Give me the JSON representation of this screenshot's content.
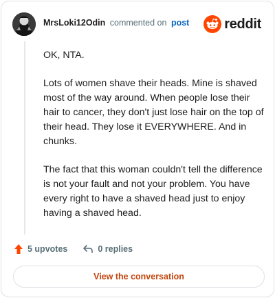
{
  "comment": {
    "username": "MrsLoki12Odin",
    "action_text": "commented on",
    "post_link": "post",
    "paragraphs": [
      "OK, NTA.",
      "Lots of women shave their heads. Mine is shaved most of the way around. When people lose their hair to cancer, they don't just lose hair on the top of their head. They lose it EVERYWHERE. And in chunks.",
      "The fact that this woman couldn't tell the difference is not your fault and not your problem. You have every right to have a shaved head just to enjoy having a shaved head."
    ]
  },
  "brand": {
    "name": "reddit",
    "accent": "#ff4500"
  },
  "stats": {
    "upvotes": "5 upvotes",
    "replies": "0 replies"
  },
  "cta_label": "View the conversation",
  "icons": [
    "avatar",
    "reddit-logo-icon",
    "upvote-arrow-icon",
    "reply-arrow-icon"
  ]
}
